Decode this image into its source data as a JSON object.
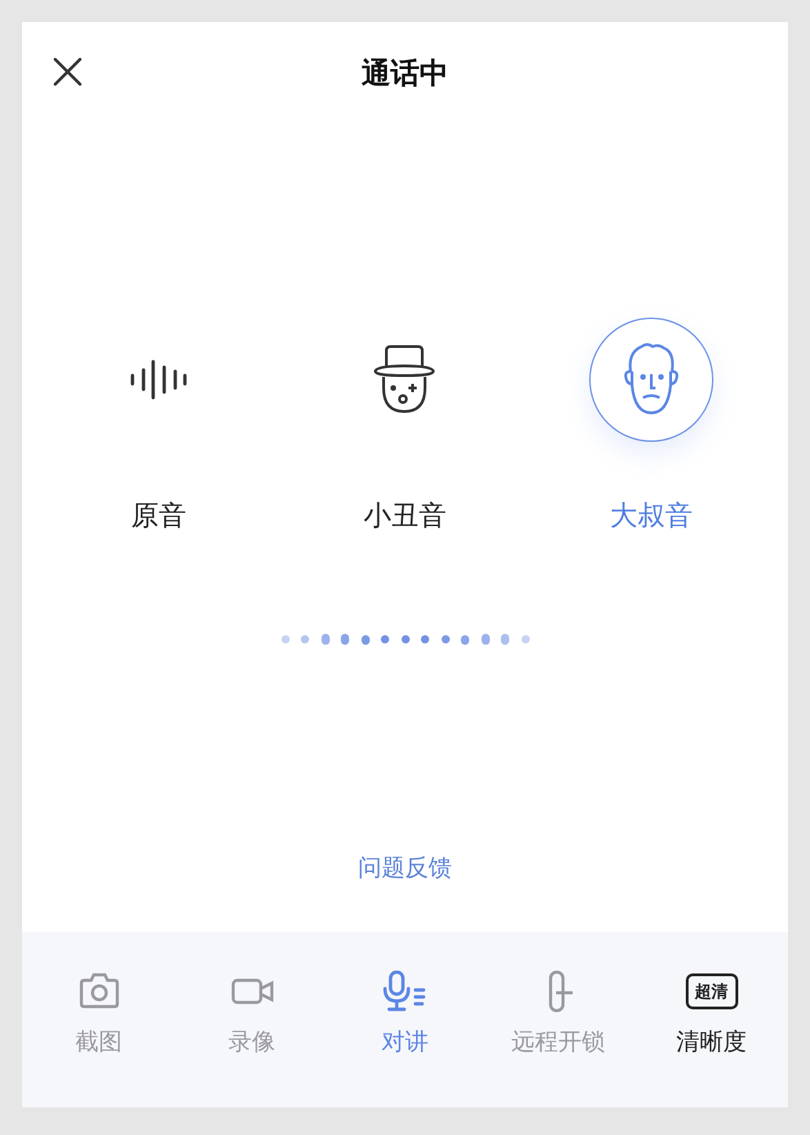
{
  "header": {
    "title": "通话中"
  },
  "voices": [
    {
      "kind": "wave",
      "label": "原音",
      "selected": false
    },
    {
      "kind": "clown",
      "label": "小丑音",
      "selected": false
    },
    {
      "kind": "uncle",
      "label": "大叔音",
      "selected": true
    }
  ],
  "feedback": "问题反馈",
  "toolbar": [
    {
      "kind": "camera",
      "label": "截图",
      "disabled": true,
      "selected": false
    },
    {
      "kind": "video",
      "label": "录像",
      "disabled": true,
      "selected": false
    },
    {
      "kind": "mic",
      "label": "对讲",
      "disabled": false,
      "selected": true
    },
    {
      "kind": "unlock",
      "label": "远程开锁",
      "disabled": true,
      "selected": false
    },
    {
      "kind": "quality",
      "label": "清晰度",
      "badge": "超清",
      "disabled": false,
      "selected": false
    }
  ]
}
